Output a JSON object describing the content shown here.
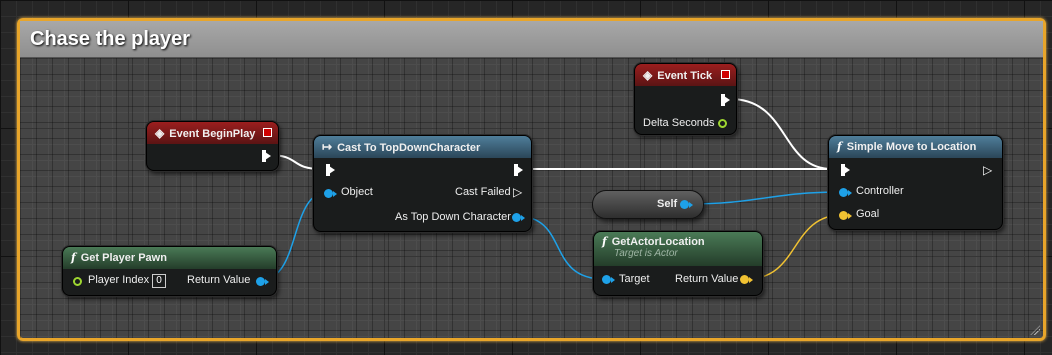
{
  "comment": {
    "title": "Chase the player"
  },
  "nodes": {
    "event_begin_play": {
      "title": "Event BeginPlay"
    },
    "event_tick": {
      "title": "Event Tick",
      "delta_seconds": "Delta Seconds"
    },
    "cast_node": {
      "title": "Cast To TopDownCharacter",
      "object": "Object",
      "cast_failed": "Cast Failed",
      "as_top_down": "As Top Down Character"
    },
    "get_player_pawn": {
      "title": "Get Player Pawn",
      "player_index_label": "Player Index",
      "player_index_value": "0",
      "return_value": "Return Value"
    },
    "self_node": {
      "label": "Self"
    },
    "get_actor_location": {
      "title": "GetActorLocation",
      "subtitle": "Target is Actor",
      "target": "Target",
      "return_value": "Return Value"
    },
    "simple_move": {
      "title": "Simple Move to Location",
      "controller": "Controller",
      "goal": "Goal"
    }
  },
  "colors": {
    "comment_border": "#e8a52a",
    "exec_wire": "#ffffff",
    "object_wire": "#1ea1e8",
    "vector_wire": "#f1c232",
    "float_pin": "#9ed631",
    "event_header": "#9b1e1e",
    "function_header": "#4f7e9a",
    "pure_header": "#4a7a56"
  },
  "icons": {
    "event": "event-diamond-icon",
    "cast": "cast-arrow-icon",
    "function": "function-f-icon"
  }
}
